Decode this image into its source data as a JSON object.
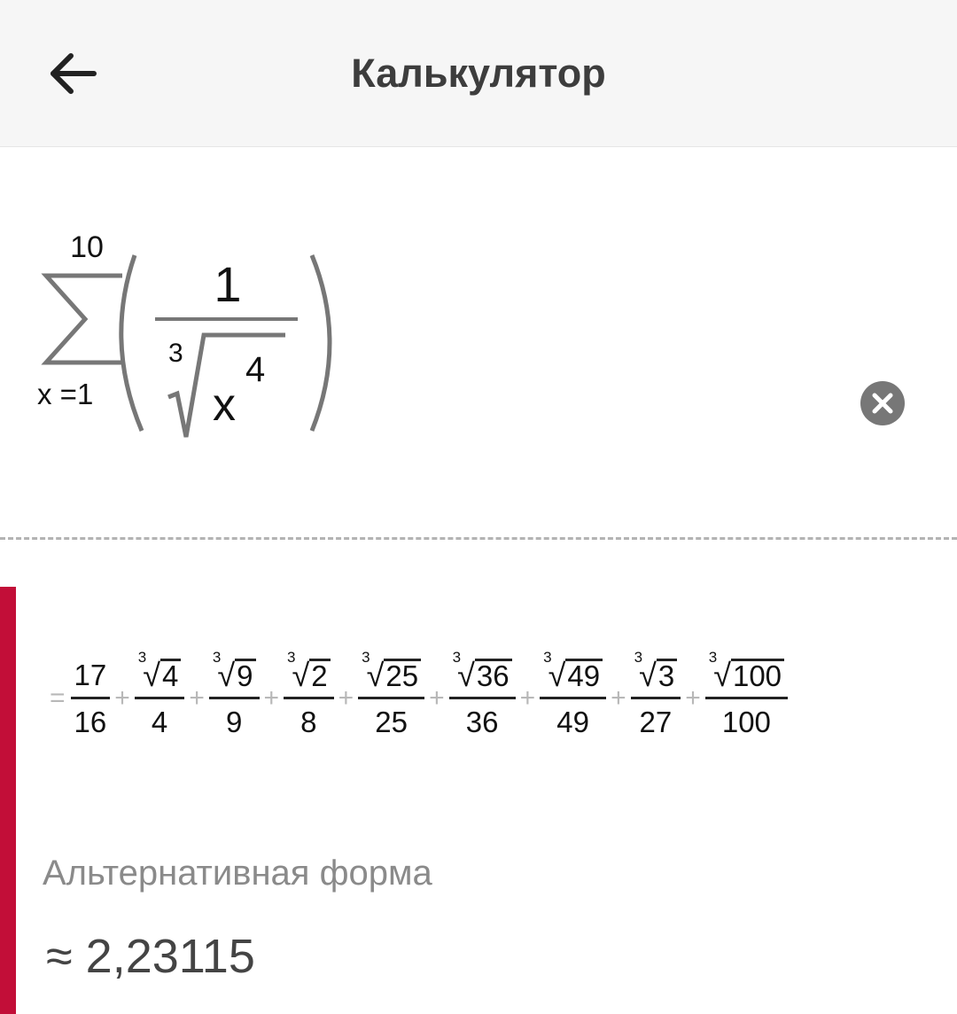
{
  "header": {
    "title": "Калькулятор",
    "back_icon": "arrow-left-icon"
  },
  "expression": {
    "sum_upper": "10",
    "sum_lower": "x =1",
    "numerator": "1",
    "root_index": "3",
    "base": "x",
    "exponent": "4",
    "clear_icon": "close-circle-icon"
  },
  "result": {
    "equals": "=",
    "plus": "+",
    "terms": [
      {
        "num": "17",
        "den": "16",
        "root": false
      },
      {
        "num": "4",
        "den": "4",
        "root": true,
        "index": "3"
      },
      {
        "num": "9",
        "den": "9",
        "root": true,
        "index": "3"
      },
      {
        "num": "2",
        "den": "8",
        "root": true,
        "index": "3"
      },
      {
        "num": "25",
        "den": "25",
        "root": true,
        "index": "3"
      },
      {
        "num": "36",
        "den": "36",
        "root": true,
        "index": "3"
      },
      {
        "num": "49",
        "den": "49",
        "root": true,
        "index": "3"
      },
      {
        "num": "3",
        "den": "27",
        "root": true,
        "index": "3"
      },
      {
        "num": "100",
        "den": "100",
        "root": true,
        "index": "3"
      }
    ],
    "alt_label": "Альтернативная форма",
    "approx_symbol": "≈",
    "approx_value": "2,23115"
  },
  "colors": {
    "accent": "#c20e38",
    "header_bg": "#f6f6f6"
  }
}
